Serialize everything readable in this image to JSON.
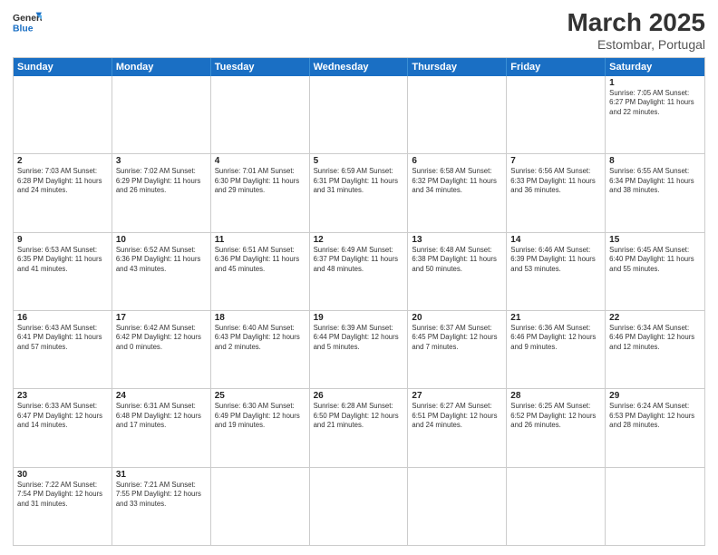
{
  "header": {
    "logo_general": "General",
    "logo_blue": "Blue",
    "month_title": "March 2025",
    "subtitle": "Estombar, Portugal"
  },
  "days_of_week": [
    "Sunday",
    "Monday",
    "Tuesday",
    "Wednesday",
    "Thursday",
    "Friday",
    "Saturday"
  ],
  "weeks": [
    [
      {
        "day": "",
        "info": ""
      },
      {
        "day": "",
        "info": ""
      },
      {
        "day": "",
        "info": ""
      },
      {
        "day": "",
        "info": ""
      },
      {
        "day": "",
        "info": ""
      },
      {
        "day": "",
        "info": ""
      },
      {
        "day": "1",
        "info": "Sunrise: 7:05 AM\nSunset: 6:27 PM\nDaylight: 11 hours\nand 22 minutes."
      }
    ],
    [
      {
        "day": "2",
        "info": "Sunrise: 7:03 AM\nSunset: 6:28 PM\nDaylight: 11 hours\nand 24 minutes."
      },
      {
        "day": "3",
        "info": "Sunrise: 7:02 AM\nSunset: 6:29 PM\nDaylight: 11 hours\nand 26 minutes."
      },
      {
        "day": "4",
        "info": "Sunrise: 7:01 AM\nSunset: 6:30 PM\nDaylight: 11 hours\nand 29 minutes."
      },
      {
        "day": "5",
        "info": "Sunrise: 6:59 AM\nSunset: 6:31 PM\nDaylight: 11 hours\nand 31 minutes."
      },
      {
        "day": "6",
        "info": "Sunrise: 6:58 AM\nSunset: 6:32 PM\nDaylight: 11 hours\nand 34 minutes."
      },
      {
        "day": "7",
        "info": "Sunrise: 6:56 AM\nSunset: 6:33 PM\nDaylight: 11 hours\nand 36 minutes."
      },
      {
        "day": "8",
        "info": "Sunrise: 6:55 AM\nSunset: 6:34 PM\nDaylight: 11 hours\nand 38 minutes."
      }
    ],
    [
      {
        "day": "9",
        "info": "Sunrise: 6:53 AM\nSunset: 6:35 PM\nDaylight: 11 hours\nand 41 minutes."
      },
      {
        "day": "10",
        "info": "Sunrise: 6:52 AM\nSunset: 6:36 PM\nDaylight: 11 hours\nand 43 minutes."
      },
      {
        "day": "11",
        "info": "Sunrise: 6:51 AM\nSunset: 6:36 PM\nDaylight: 11 hours\nand 45 minutes."
      },
      {
        "day": "12",
        "info": "Sunrise: 6:49 AM\nSunset: 6:37 PM\nDaylight: 11 hours\nand 48 minutes."
      },
      {
        "day": "13",
        "info": "Sunrise: 6:48 AM\nSunset: 6:38 PM\nDaylight: 11 hours\nand 50 minutes."
      },
      {
        "day": "14",
        "info": "Sunrise: 6:46 AM\nSunset: 6:39 PM\nDaylight: 11 hours\nand 53 minutes."
      },
      {
        "day": "15",
        "info": "Sunrise: 6:45 AM\nSunset: 6:40 PM\nDaylight: 11 hours\nand 55 minutes."
      }
    ],
    [
      {
        "day": "16",
        "info": "Sunrise: 6:43 AM\nSunset: 6:41 PM\nDaylight: 11 hours\nand 57 minutes."
      },
      {
        "day": "17",
        "info": "Sunrise: 6:42 AM\nSunset: 6:42 PM\nDaylight: 12 hours\nand 0 minutes."
      },
      {
        "day": "18",
        "info": "Sunrise: 6:40 AM\nSunset: 6:43 PM\nDaylight: 12 hours\nand 2 minutes."
      },
      {
        "day": "19",
        "info": "Sunrise: 6:39 AM\nSunset: 6:44 PM\nDaylight: 12 hours\nand 5 minutes."
      },
      {
        "day": "20",
        "info": "Sunrise: 6:37 AM\nSunset: 6:45 PM\nDaylight: 12 hours\nand 7 minutes."
      },
      {
        "day": "21",
        "info": "Sunrise: 6:36 AM\nSunset: 6:46 PM\nDaylight: 12 hours\nand 9 minutes."
      },
      {
        "day": "22",
        "info": "Sunrise: 6:34 AM\nSunset: 6:46 PM\nDaylight: 12 hours\nand 12 minutes."
      }
    ],
    [
      {
        "day": "23",
        "info": "Sunrise: 6:33 AM\nSunset: 6:47 PM\nDaylight: 12 hours\nand 14 minutes."
      },
      {
        "day": "24",
        "info": "Sunrise: 6:31 AM\nSunset: 6:48 PM\nDaylight: 12 hours\nand 17 minutes."
      },
      {
        "day": "25",
        "info": "Sunrise: 6:30 AM\nSunset: 6:49 PM\nDaylight: 12 hours\nand 19 minutes."
      },
      {
        "day": "26",
        "info": "Sunrise: 6:28 AM\nSunset: 6:50 PM\nDaylight: 12 hours\nand 21 minutes."
      },
      {
        "day": "27",
        "info": "Sunrise: 6:27 AM\nSunset: 6:51 PM\nDaylight: 12 hours\nand 24 minutes."
      },
      {
        "day": "28",
        "info": "Sunrise: 6:25 AM\nSunset: 6:52 PM\nDaylight: 12 hours\nand 26 minutes."
      },
      {
        "day": "29",
        "info": "Sunrise: 6:24 AM\nSunset: 6:53 PM\nDaylight: 12 hours\nand 28 minutes."
      }
    ],
    [
      {
        "day": "30",
        "info": "Sunrise: 7:22 AM\nSunset: 7:54 PM\nDaylight: 12 hours\nand 31 minutes."
      },
      {
        "day": "31",
        "info": "Sunrise: 7:21 AM\nSunset: 7:55 PM\nDaylight: 12 hours\nand 33 minutes."
      },
      {
        "day": "",
        "info": ""
      },
      {
        "day": "",
        "info": ""
      },
      {
        "day": "",
        "info": ""
      },
      {
        "day": "",
        "info": ""
      },
      {
        "day": "",
        "info": ""
      }
    ]
  ]
}
